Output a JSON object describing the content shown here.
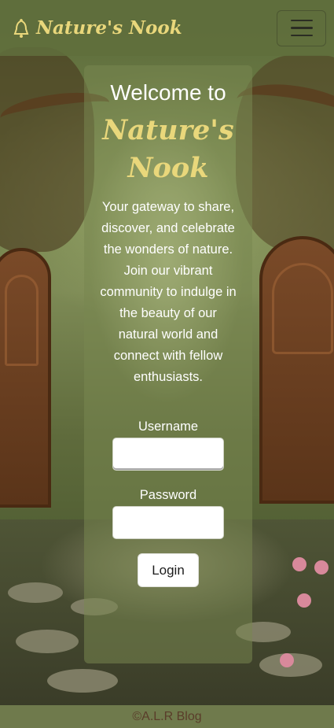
{
  "navbar": {
    "brand_icon": "bell-icon",
    "brand_text": "Nature's Nook",
    "toggler_icon": "hamburger-icon"
  },
  "hero": {
    "welcome": "Welcome to",
    "brand_line1": "Nature's",
    "brand_line2": "Nook",
    "intro": "Your gateway to share, discover, and celebrate the wonders of nature. Join our vibrant community to indulge in the beauty of our natural world and connect with fellow enthusiasts."
  },
  "login_form": {
    "username_label": "Username",
    "username_value": "",
    "password_label": "Password",
    "password_value": "",
    "login_button": "Login"
  },
  "footer": {
    "text": "©A.L.R Blog"
  },
  "colors": {
    "brand": "#e9d77b",
    "navbar": "#606e3c",
    "footer_text": "#5a3d2a"
  }
}
